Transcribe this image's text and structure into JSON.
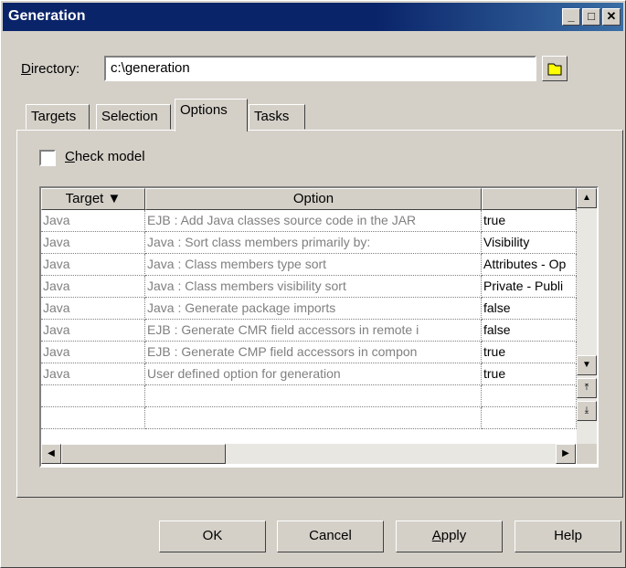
{
  "window": {
    "title": "Generation"
  },
  "directory": {
    "label_u": "D",
    "label_rest": "irectory:",
    "value": "c:\\generation"
  },
  "tabs": [
    {
      "label": "Targets"
    },
    {
      "label": "Selection"
    },
    {
      "label": "Options"
    },
    {
      "label": "Tasks"
    }
  ],
  "check_model": {
    "label_u": "C",
    "label_rest": "heck model",
    "checked": false
  },
  "grid": {
    "columns": [
      "Target",
      "Option",
      ""
    ],
    "rows": [
      {
        "target": "Java",
        "option": "EJB : Add Java classes source code in the JAR",
        "value": "true"
      },
      {
        "target": "Java",
        "option": "Java : Sort class members primarily by:",
        "value": "Visibility"
      },
      {
        "target": "Java",
        "option": "Java : Class members type sort",
        "value": "Attributes - Op"
      },
      {
        "target": "Java",
        "option": "Java : Class members visibility sort",
        "value": "Private - Publi"
      },
      {
        "target": "Java",
        "option": "Java : Generate package imports",
        "value": "false"
      },
      {
        "target": "Java",
        "option": "EJB : Generate CMR field accessors in remote i",
        "value": "false"
      },
      {
        "target": "Java",
        "option": "EJB : Generate CMP field accessors in compon",
        "value": "true"
      },
      {
        "target": "Java",
        "option": "User defined option for generation",
        "value": "true"
      }
    ]
  },
  "buttons": {
    "ok": "OK",
    "cancel": "Cancel",
    "apply_u": "A",
    "apply_rest": "pply",
    "help": "Help"
  },
  "icons": {
    "folder": "folder-icon",
    "minimize": "minimize-icon",
    "maximize": "maximize-icon",
    "close": "close-icon"
  }
}
